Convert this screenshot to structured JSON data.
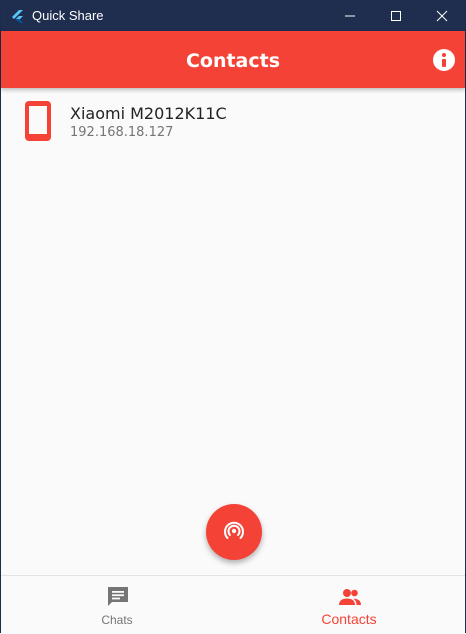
{
  "window": {
    "title": "Quick Share"
  },
  "appbar": {
    "title": "Contacts"
  },
  "contacts": [
    {
      "name": "Xiaomi M2012K11C",
      "ip": "192.168.18.127"
    }
  ],
  "bottom_nav": {
    "items": [
      {
        "label": "Chats",
        "icon": "chat-icon",
        "active": false
      },
      {
        "label": "Contacts",
        "icon": "people-icon",
        "active": true
      }
    ]
  },
  "colors": {
    "accent": "#f44336",
    "titlebar": "#1f2d4f",
    "inactive": "#757575"
  }
}
